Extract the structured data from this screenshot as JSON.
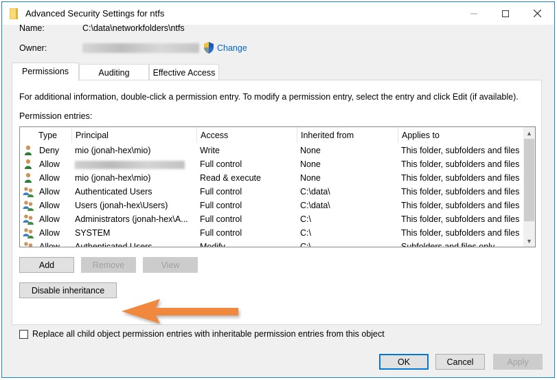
{
  "window": {
    "title": "Advanced Security Settings for ntfs"
  },
  "header": {
    "name_label": "Name:",
    "name_value": "C:\\data\\networkfolders\\ntfs",
    "owner_label": "Owner:",
    "change_link": "Change"
  },
  "tabs": [
    {
      "label": "Permissions",
      "active": true
    },
    {
      "label": "Auditing",
      "active": false
    },
    {
      "label": "Effective Access",
      "active": false
    }
  ],
  "permissions": {
    "info_text": "For additional information, double-click a permission entry. To modify a permission entry, select the entry and click Edit (if available).",
    "entries_label": "Permission entries:",
    "columns": [
      "Type",
      "Principal",
      "Access",
      "Inherited from",
      "Applies to"
    ],
    "rows": [
      {
        "icon": "user-icon",
        "type": "Deny",
        "principal": "mio (jonah-hex\\mio)",
        "access": "Write",
        "inherited": "None",
        "applies": "This folder, subfolders and files"
      },
      {
        "icon": "user-icon",
        "type": "Allow",
        "principal": "",
        "access": "Full control",
        "inherited": "None",
        "applies": "This folder, subfolders and files"
      },
      {
        "icon": "user-icon",
        "type": "Allow",
        "principal": "mio (jonah-hex\\mio)",
        "access": "Read & execute",
        "inherited": "None",
        "applies": "This folder, subfolders and files"
      },
      {
        "icon": "group-icon",
        "type": "Allow",
        "principal": "Authenticated Users",
        "access": "Full control",
        "inherited": "C:\\data\\",
        "applies": "This folder, subfolders and files"
      },
      {
        "icon": "group-icon",
        "type": "Allow",
        "principal": "Users (jonah-hex\\Users)",
        "access": "Full control",
        "inherited": "C:\\data\\",
        "applies": "This folder, subfolders and files"
      },
      {
        "icon": "group-icon",
        "type": "Allow",
        "principal": "Administrators (jonah-hex\\A...",
        "access": "Full control",
        "inherited": "C:\\",
        "applies": "This folder, subfolders and files"
      },
      {
        "icon": "group-icon",
        "type": "Allow",
        "principal": "SYSTEM",
        "access": "Full control",
        "inherited": "C:\\",
        "applies": "This folder, subfolders and files"
      },
      {
        "icon": "group-icon",
        "type": "Allow",
        "principal": "Authenticated Users",
        "access": "Modify",
        "inherited": "C:\\",
        "applies": "Subfolders and files only"
      }
    ]
  },
  "buttons": {
    "add": "Add",
    "remove": "Remove",
    "view": "View",
    "disable_inheritance": "Disable inheritance",
    "ok": "OK",
    "cancel": "Cancel",
    "apply": "Apply"
  },
  "replace_checkbox": {
    "label": "Replace all child object permission entries with inheritable permission entries from this object",
    "checked": false
  },
  "colors": {
    "accent": "#0078d7",
    "link": "#0066cc",
    "annotation_arrow": "#f0883e"
  }
}
